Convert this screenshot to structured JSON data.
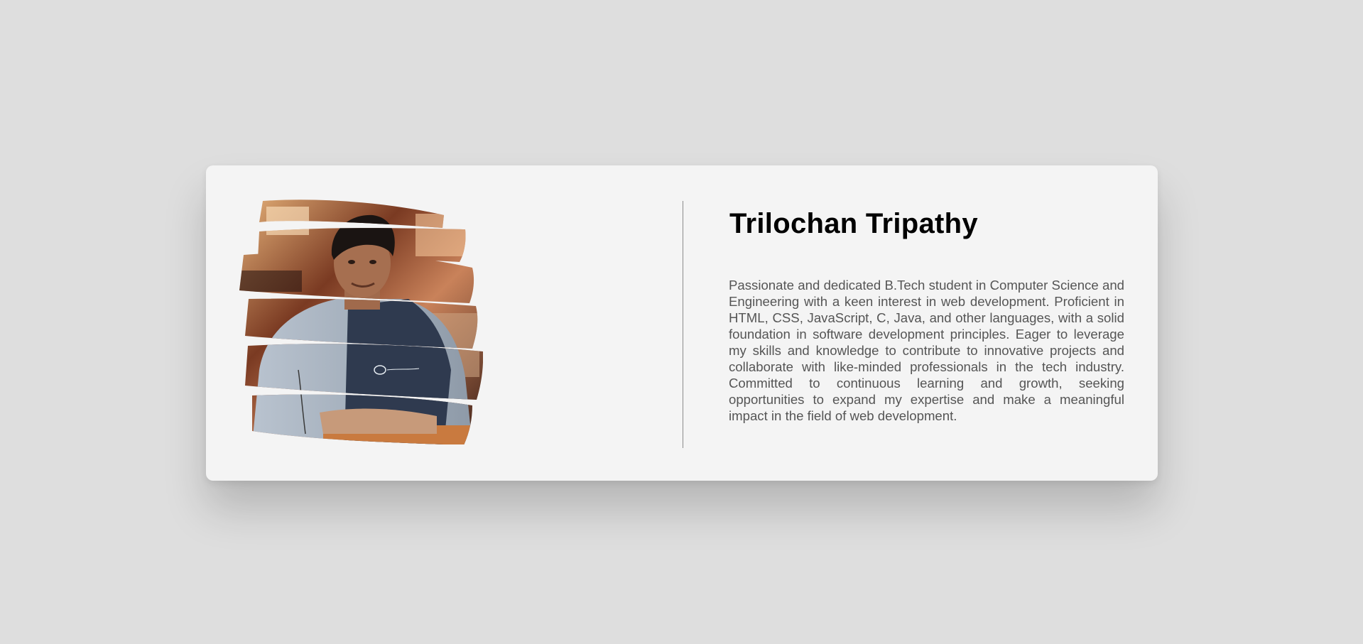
{
  "profile": {
    "name": "Trilochan Tripathy",
    "bio": "Passionate and dedicated B.Tech student in Computer Science and Engineering with a keen interest in web development. Proficient in HTML, CSS, JavaScript, C, Java, and other languages, with a solid foundation in software development principles. Eager to leverage my skills and knowledge to contribute to innovative projects and collaborate with like-minded professionals in the tech industry. Committed to continuous learning and growth, seeking opportunities to expand my expertise and make a meaningful impact in the field of web development.",
    "photo_icon": "person-photo"
  },
  "colors": {
    "background": "#dedede",
    "card": "#f4f4f4",
    "name": "#000000",
    "bio": "#555555",
    "divider": "#8a8a8a"
  }
}
